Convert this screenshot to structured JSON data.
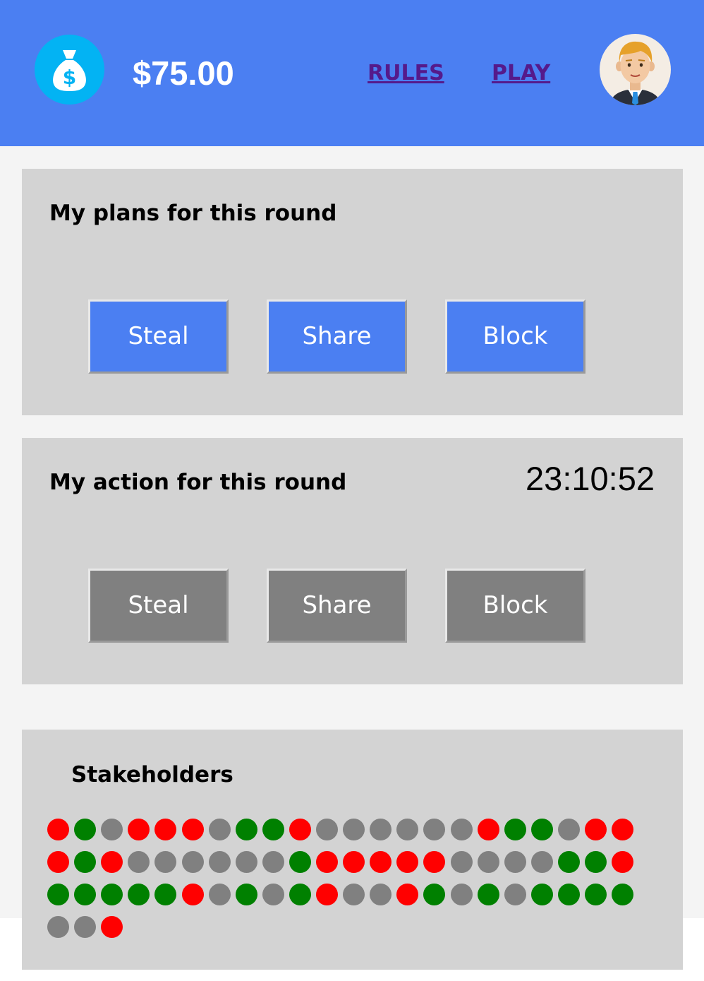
{
  "header": {
    "money_icon": "money-bag-icon",
    "balance": "$75.00",
    "nav": [
      {
        "label": "RULES"
      },
      {
        "label": "PLAY"
      }
    ],
    "avatar_icon": "user-avatar-icon"
  },
  "plans": {
    "title": "My plans for this round",
    "buttons": [
      {
        "label": "Steal"
      },
      {
        "label": "Share"
      },
      {
        "label": "Block"
      }
    ],
    "button_color": "#4b7ff2"
  },
  "action": {
    "title": "My action for this round",
    "timer": "23:10:52",
    "buttons": [
      {
        "label": "Steal"
      },
      {
        "label": "Share"
      },
      {
        "label": "Block"
      }
    ],
    "button_color": "#808080"
  },
  "stakeholders": {
    "title": "Stakeholders",
    "colors": {
      "red": "#ff0000",
      "green": "#008000",
      "gray": "#808080"
    },
    "dots": [
      "red",
      "green",
      "gray",
      "red",
      "red",
      "red",
      "gray",
      "green",
      "green",
      "red",
      "gray",
      "gray",
      "gray",
      "gray",
      "gray",
      "gray",
      "red",
      "green",
      "green",
      "gray",
      "red",
      "red",
      "red",
      "green",
      "red",
      "gray",
      "gray",
      "gray",
      "gray",
      "gray",
      "gray",
      "green",
      "red",
      "red",
      "red",
      "red",
      "red",
      "gray",
      "gray",
      "gray",
      "gray",
      "green",
      "green",
      "red",
      "green",
      "green",
      "green",
      "green",
      "green",
      "red",
      "gray",
      "green",
      "gray",
      "green",
      "red",
      "gray",
      "gray",
      "red",
      "green",
      "gray",
      "green",
      "gray",
      "green",
      "green",
      "green",
      "green",
      "gray",
      "gray",
      "red"
    ]
  }
}
